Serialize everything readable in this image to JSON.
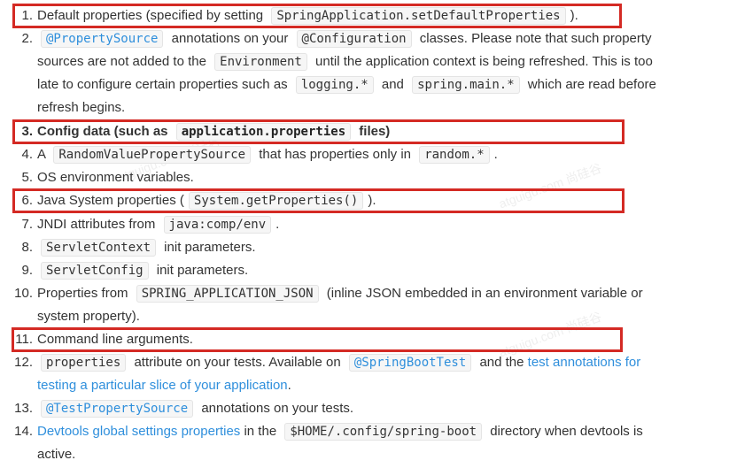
{
  "items": [
    {
      "num": "1.",
      "t0": "Default properties (specified by setting ",
      "c0": "SpringApplication.setDefaultProperties",
      "t1": ")."
    },
    {
      "num": "2.",
      "c0": "@PropertySource",
      "t0": " annotations on your ",
      "c1": "@Configuration",
      "t1": " classes. Please note that such property sources are not added to the ",
      "c2": "Environment",
      "t2": " until the application context is being refreshed. This is too late to configure certain properties such as ",
      "c3": "logging.*",
      "t3": " and ",
      "c4": "spring.main.*",
      "t4": " which are read before refresh begins."
    },
    {
      "num": "3.",
      "t0": "Config data (such as ",
      "c0": "application.properties",
      "t1": " files)"
    },
    {
      "num": "4.",
      "t0": "A ",
      "c0": "RandomValuePropertySource",
      "t1": " that has properties only in ",
      "c1": "random.*",
      "t2": "."
    },
    {
      "num": "5.",
      "t0": "OS environment variables."
    },
    {
      "num": "6.",
      "t0": "Java System properties (",
      "c0": "System.getProperties()",
      "t1": ")."
    },
    {
      "num": "7.",
      "t0": "JNDI attributes from ",
      "c0": "java:comp/env",
      "t1": "."
    },
    {
      "num": "8.",
      "c0": "ServletContext",
      "t0": " init parameters."
    },
    {
      "num": "9.",
      "c0": "ServletConfig",
      "t0": " init parameters."
    },
    {
      "num": "10.",
      "t0": "Properties from ",
      "c0": "SPRING_APPLICATION_JSON",
      "t1": " (inline JSON embedded in an environment variable or system property)."
    },
    {
      "num": "11.",
      "t0": "Command line arguments."
    },
    {
      "num": "12.",
      "c0": "properties",
      "t0": " attribute on your tests. Available on ",
      "c1": "@SpringBootTest",
      "t1": " and the ",
      "l0": "test annotations for testing a particular slice of your application",
      "t2": "."
    },
    {
      "num": "13.",
      "c0": "@TestPropertySource",
      "t0": " annotations on your tests."
    },
    {
      "num": "14.",
      "l0": "Devtools global settings properties",
      "t0": " in the ",
      "c0": "$HOME/.config/spring-boot",
      "t1": " directory when devtools is active."
    }
  ],
  "watermark": {
    "text1": "atguigu.com 尚硅谷"
  },
  "colors": {
    "highlight": "#d42a24",
    "link": "#2f8fdc",
    "text": "#333333"
  }
}
